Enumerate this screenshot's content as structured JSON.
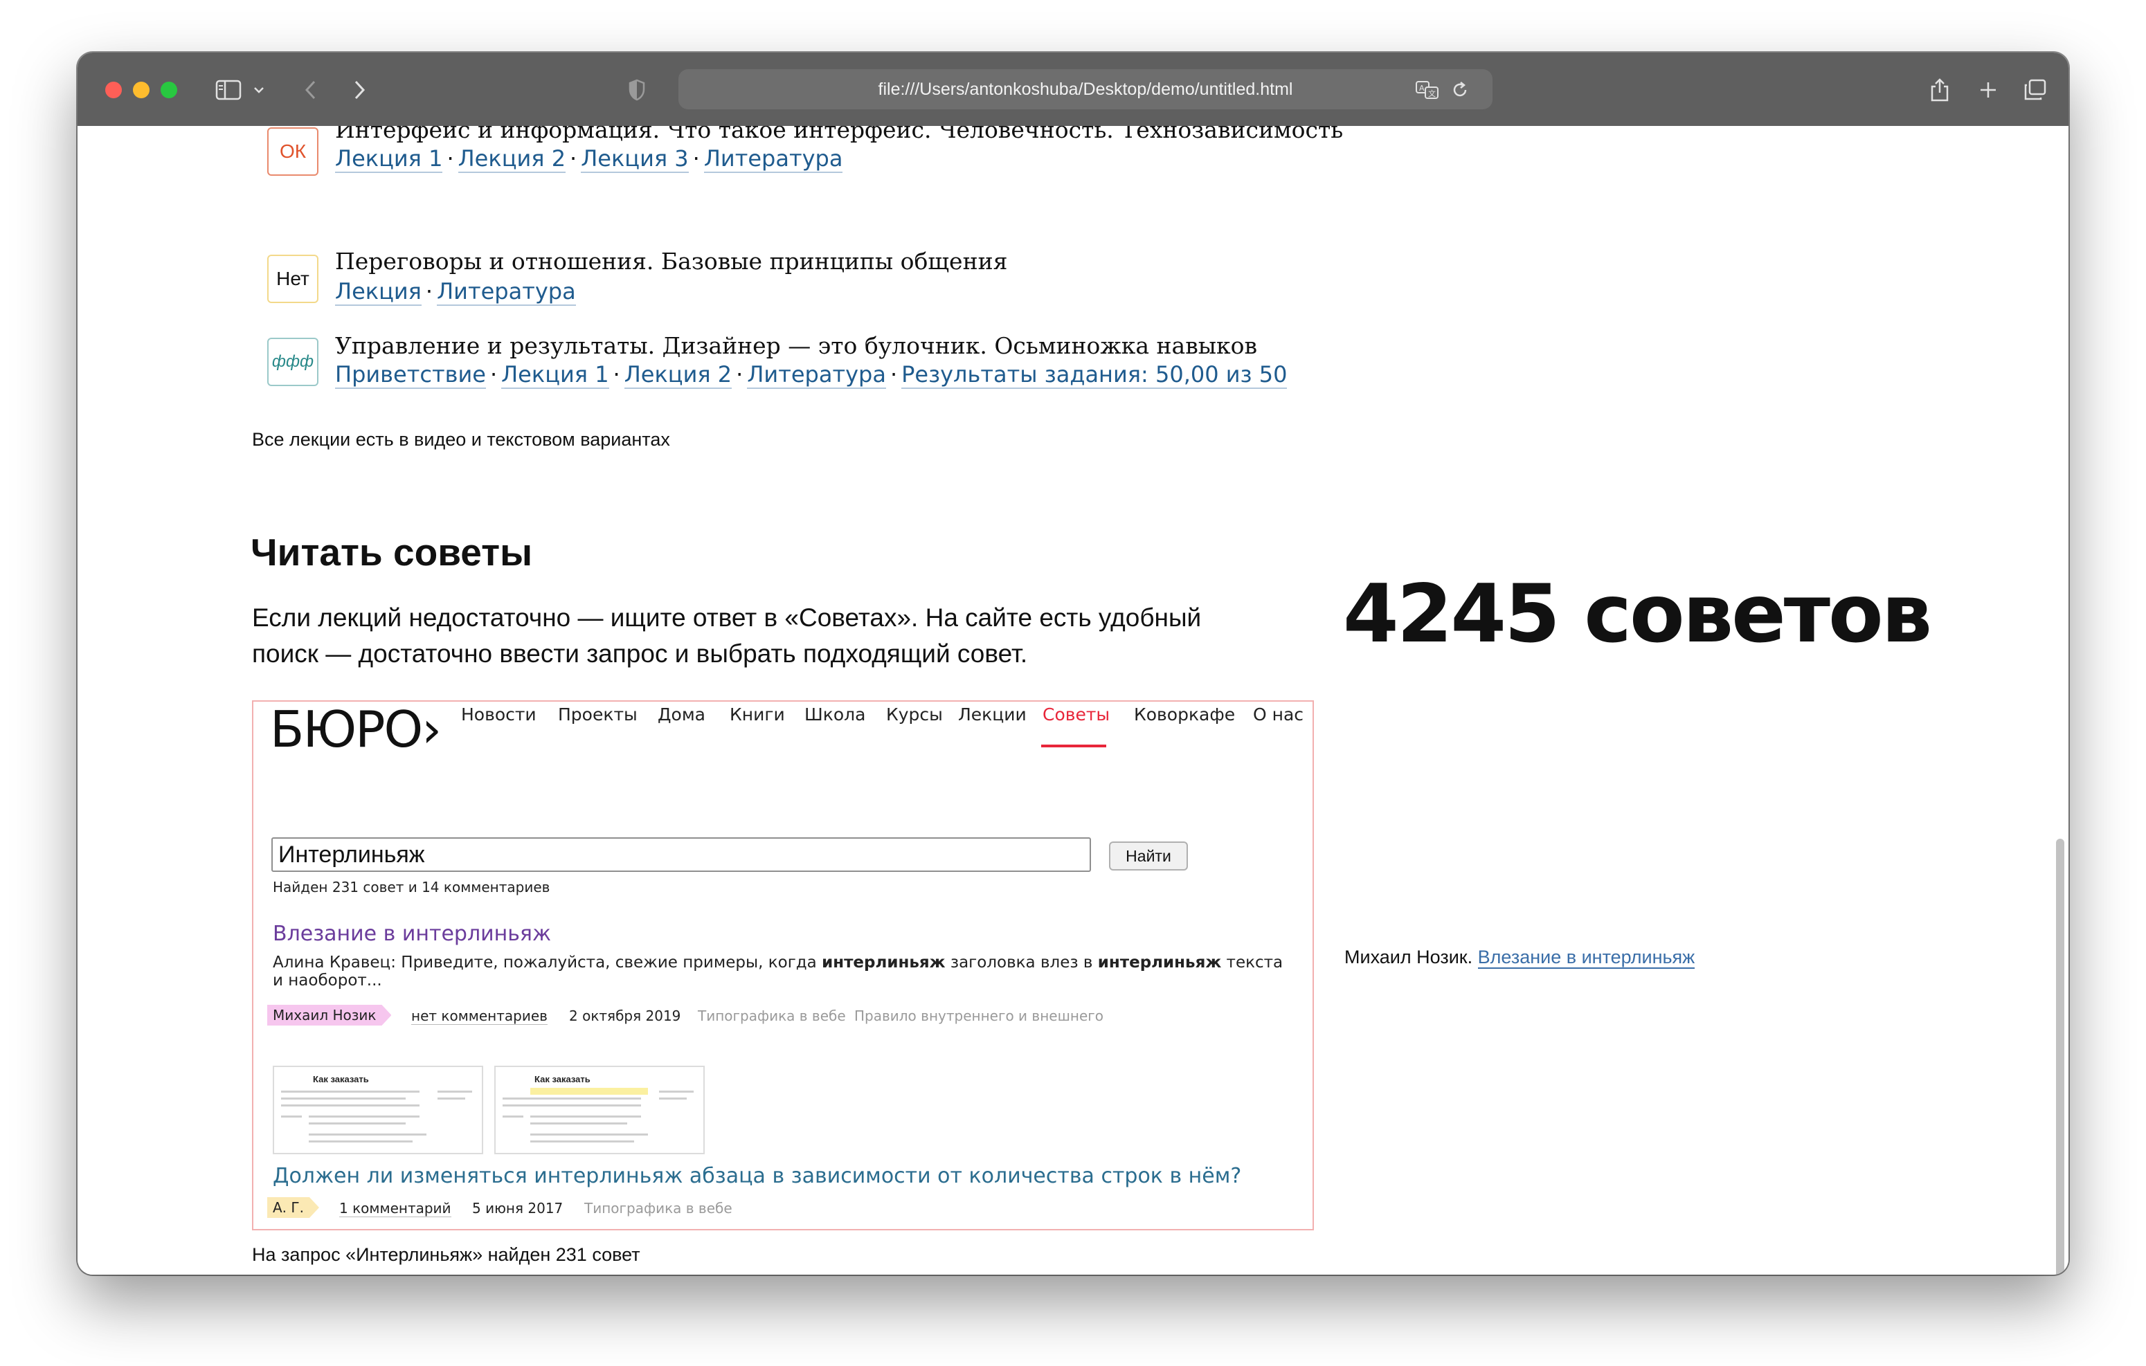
{
  "browser": {
    "url": "file:///Users/antonkoshuba/Desktop/demo/untitled.html"
  },
  "lectures": [
    {
      "badge": "ОК",
      "badge_color": "#e0532c",
      "title": "Интерфейс и информация. Что такое интерфейс. Человечность. Технозависимость",
      "links": [
        "Лекция 1",
        "Лекция 2",
        "Лекция 3",
        "Литература"
      ]
    },
    {
      "badge": "Нет",
      "badge_color": "#111111",
      "title": "Переговоры и отношения. Базовые принципы общения",
      "links": [
        "Лекция",
        "Литература"
      ]
    },
    {
      "badge": "ффф",
      "badge_color": "#2a8a8a",
      "title": "Управление и результаты. Дизайнер — это булочник. Осьминожка навыков",
      "links": [
        "Приветствие",
        "Лекция 1",
        "Лекция 2",
        "Литература",
        "Результаты задания: 50,00 из 50"
      ]
    }
  ],
  "lectures_note": "Все лекции есть в видео и текстовом вариантах",
  "tips": {
    "heading": "Читать советы",
    "para_line1": "Если лекций недостаточно — ищите ответ в «Советах». На сайте есть удобный",
    "para_line2": "поиск — достаточно ввести запрос и выбрать подходящий совет.",
    "big_count": "4245 советов",
    "side_author": "Михаил Нозик.",
    "side_link": "Влезание в интерлиньяж",
    "caption": "На запрос «Интерлиньяж» найден 231 совет"
  },
  "bureau": {
    "logo": "БЮРО›",
    "nav": [
      "Новости",
      "Проекты",
      "Дома",
      "Книги",
      "Школа",
      "Курсы",
      "Лекции",
      "Советы",
      "Коворкафе",
      "О нас"
    ],
    "active_nav": "Советы",
    "search_value": "Интерлиньяж",
    "search_button": "Найти",
    "found": "Найден 231 совет и 14 комментариев",
    "accent": "#e8263a",
    "results": [
      {
        "title": "Влезание в интерлиньяж",
        "snippet_a": "Алина Кравец: Приведите, пожалуйста, свежие примеры, когда ",
        "snippet_b": "интерлиньяж",
        "snippet_c": " заголовка влез в ",
        "snippet_d": "интерлиньяж",
        "snippet_e": " текста",
        "snippet_line2": "и наоборот...",
        "author": "Михаил Нозик",
        "comments": "нет комментариев",
        "date": "2 октября 2019",
        "tags": [
          "Типографика в вебе",
          "Правило внутреннего и внешнего"
        ]
      },
      {
        "title": "Должен ли изменяться интерлиньяж абзаца в зависимости от количества строк в нём?",
        "author": "А. Г.",
        "comments": "1 комментарий",
        "date": "5 июня 2017",
        "tags": [
          "Типографика в вебе"
        ]
      }
    ],
    "thumb_title": "Как заказать"
  }
}
